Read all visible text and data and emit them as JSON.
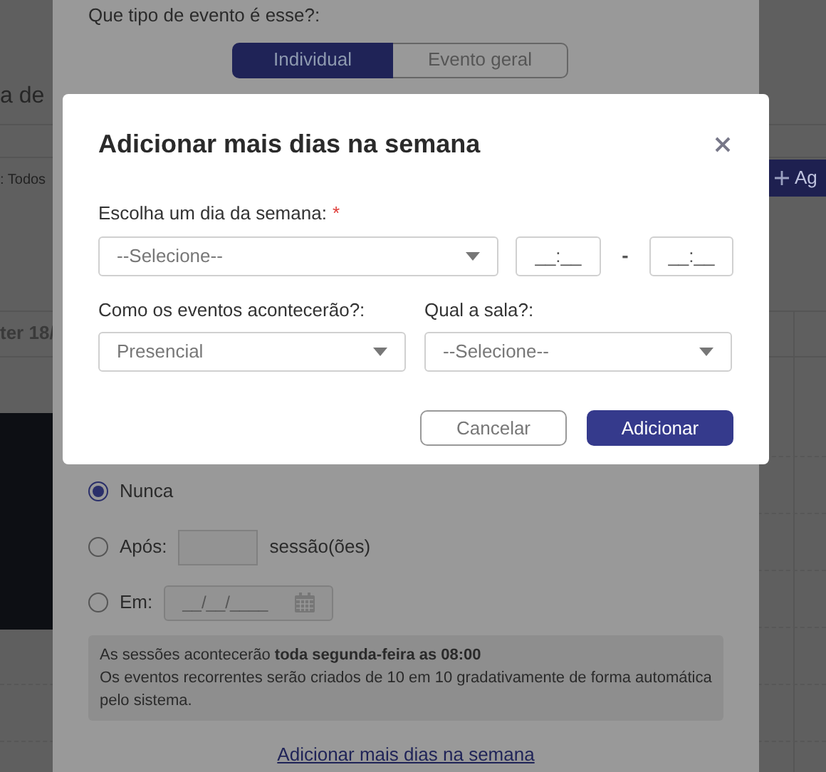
{
  "background": {
    "heading": "a de",
    "filter": ": Todos",
    "add_button": "Ag",
    "date_column": "ter 18/"
  },
  "event_form": {
    "type_question": "Que tipo de evento é esse?:",
    "type_options": [
      {
        "label": "Individual",
        "selected": true
      },
      {
        "label": "Evento geral",
        "selected": false
      }
    ],
    "end_options": [
      {
        "kind": "never",
        "label": "Nunca",
        "selected": true
      },
      {
        "kind": "count",
        "label": "Após:",
        "suffix": "sessão(ões)",
        "selected": false
      },
      {
        "kind": "date",
        "label": "Em:",
        "placeholder": "__/__/____",
        "selected": false
      }
    ],
    "info": [
      "As sessões acontecerão **toda segunda-feira as 08:00**",
      "Os eventos recorrentes serão criados de 10 em 10 gradativamente de forma automática pelo sistema."
    ],
    "add_days_link": "Adicionar mais dias na semana"
  },
  "dialog": {
    "title": "Adicionar mais dias na semana",
    "weekday": {
      "label": "Escolha um dia da semana:",
      "required_mark": "*",
      "placeholder": "--Selecione--"
    },
    "time_start": {
      "placeholder": "__:__"
    },
    "time_separator": "-",
    "time_end": {
      "placeholder": "__:__"
    },
    "mode": {
      "label": "Como os eventos acontecerão?:",
      "value": "Presencial"
    },
    "room": {
      "label": "Qual a sala?:",
      "placeholder": "--Selecione--"
    },
    "buttons": [
      {
        "kind": "secondary",
        "label": "Cancelar"
      },
      {
        "kind": "primary",
        "label": "Adicionar"
      }
    ]
  }
}
